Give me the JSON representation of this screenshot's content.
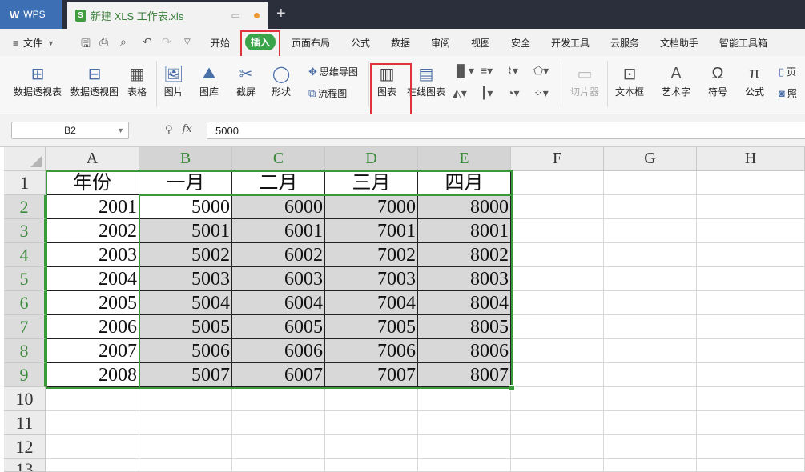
{
  "titlebar": {
    "app_tab": "WPS",
    "doc_tab": "新建 XLS 工作表.xls",
    "doc_icon_letter": "S",
    "new_tab_icon": "plus-icon"
  },
  "menubar": {
    "file_label": "文件",
    "tabs": [
      "开始",
      "插入",
      "页面布局",
      "公式",
      "数据",
      "审阅",
      "视图",
      "安全",
      "开发工具",
      "云服务",
      "文档助手",
      "智能工具箱"
    ],
    "active_tab": "插入"
  },
  "ribbon": {
    "pivot_table": "数据透视表",
    "pivot_chart": "数据透视图",
    "table": "表格",
    "picture": "图片",
    "gallery": "图库",
    "screenshot": "截屏",
    "shapes": "形状",
    "mindmap": "思维导图",
    "flowchart": "流程图",
    "chart": "图表",
    "online_chart": "在线图表",
    "slicer": "切片器",
    "textbox": "文本框",
    "wordart": "艺术字",
    "symbol": "符号",
    "formula": "公式",
    "page_cut": "页",
    "photo_cut": "照"
  },
  "formula_bar": {
    "name_box": "B2",
    "fx_label": "fx",
    "value": "5000"
  },
  "sheet": {
    "columns": [
      "A",
      "B",
      "C",
      "D",
      "E",
      "F",
      "G",
      "H"
    ],
    "selected_columns": [
      "B",
      "C",
      "D",
      "E"
    ],
    "row_numbers": [
      "1",
      "2",
      "3",
      "4",
      "5",
      "6",
      "7",
      "8",
      "9",
      "10",
      "11",
      "12",
      "13"
    ],
    "selected_rows": [
      "2",
      "3",
      "4",
      "5",
      "6",
      "7",
      "8",
      "9"
    ],
    "header_row": [
      "年份",
      "一月",
      "二月",
      "三月",
      "四月"
    ],
    "data_rows": [
      [
        "2001",
        "5000",
        "6000",
        "7000",
        "8000"
      ],
      [
        "2002",
        "5001",
        "6001",
        "7001",
        "8001"
      ],
      [
        "2003",
        "5002",
        "6002",
        "7002",
        "8002"
      ],
      [
        "2004",
        "5003",
        "6003",
        "7003",
        "8003"
      ],
      [
        "2005",
        "5004",
        "6004",
        "7004",
        "8004"
      ],
      [
        "2006",
        "5005",
        "6005",
        "7005",
        "8005"
      ],
      [
        "2007",
        "5006",
        "6006",
        "7006",
        "8006"
      ],
      [
        "2008",
        "5007",
        "6007",
        "7007",
        "8007"
      ]
    ]
  },
  "colors": {
    "accent_green": "#3aa44b",
    "highlight_red": "#e0333c",
    "wps_blue": "#3d6fb5"
  }
}
